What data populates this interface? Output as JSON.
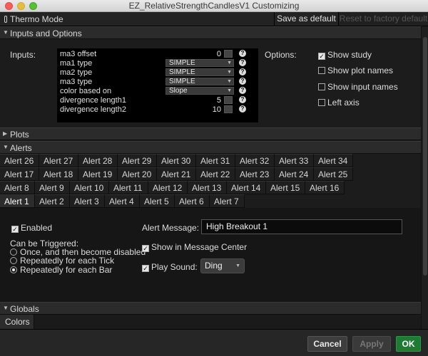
{
  "window": {
    "title": "EZ_RelativeStrengthCandlesV1 Customizing"
  },
  "toolbar": {
    "mode": "Thermo Mode",
    "save_default": "Save as default",
    "reset_factory": "Reset to factory default"
  },
  "inputs_section": {
    "title": "Inputs and Options",
    "inputs_label": "Inputs:",
    "options_label": "Options:",
    "rows": [
      {
        "name": "ma3 offset",
        "value": "0"
      },
      {
        "name": "ma1 type",
        "value": "SIMPLE"
      },
      {
        "name": "ma2 type",
        "value": "SIMPLE"
      },
      {
        "name": "ma3 type",
        "value": "SIMPLE"
      },
      {
        "name": "color based on",
        "value": "Slope"
      },
      {
        "name": "divergence length1",
        "value": "5"
      },
      {
        "name": "divergence length2",
        "value": "10"
      }
    ],
    "options": [
      {
        "label": "Show study",
        "checked": true
      },
      {
        "label": "Show plot names",
        "checked": false
      },
      {
        "label": "Show input names",
        "checked": false
      },
      {
        "label": "Left axis",
        "checked": false
      }
    ]
  },
  "plots_section": {
    "title": "Plots"
  },
  "alerts_section": {
    "title": "Alerts",
    "tab_rows": [
      [
        "Alert 26",
        "Alert 27",
        "Alert 28",
        "Alert 29",
        "Alert 30",
        "Alert 31",
        "Alert 32",
        "Alert 33",
        "Alert 34"
      ],
      [
        "Alert 17",
        "Alert 18",
        "Alert 19",
        "Alert 20",
        "Alert 21",
        "Alert 22",
        "Alert 23",
        "Alert 24",
        "Alert 25"
      ],
      [
        "Alert 8",
        "Alert 9",
        "Alert 10",
        "Alert 11",
        "Alert 12",
        "Alert 13",
        "Alert 14",
        "Alert 15",
        "Alert 16"
      ],
      [
        "Alert 1",
        "Alert 2",
        "Alert 3",
        "Alert 4",
        "Alert 5",
        "Alert 6",
        "Alert 7"
      ]
    ],
    "active_tab": "Alert 1",
    "enabled_label": "Enabled",
    "triggered_label": "Can be Triggered:",
    "trigger_options": [
      "Once, and then become disabled",
      "Repeatedly for each Tick",
      "Repeatedly for each Bar"
    ],
    "selected_trigger": "Repeatedly for each Bar",
    "message_label": "Alert Message:",
    "message_value": "High Breakout 1",
    "show_in_center": "Show in Message Center",
    "play_sound_label": "Play Sound:",
    "sound_value": "Ding"
  },
  "globals_section": {
    "title": "Globals",
    "tab": "Colors"
  },
  "footer": {
    "cancel": "Cancel",
    "apply": "Apply",
    "ok": "OK"
  },
  "colors": {
    "ok_button": "#1f7a34",
    "panel_bg": "#1c1c1c"
  },
  "icons": {
    "collapse": "chevron-down-icon",
    "expand": "chevron-right-icon",
    "help": "question-icon"
  }
}
